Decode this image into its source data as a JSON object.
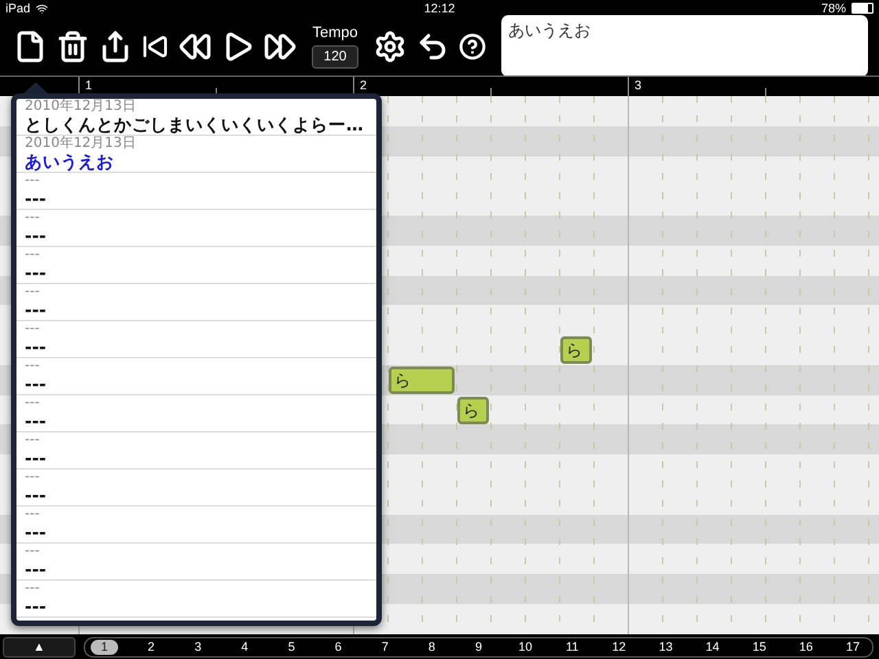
{
  "status_bar": {
    "device": "iPad",
    "time": "12:12",
    "battery": "78%"
  },
  "toolbar": {
    "tempo_label": "Tempo",
    "tempo_value": "120",
    "lyrics": "あいうえお"
  },
  "ruler": [
    "1",
    "2",
    "3"
  ],
  "song_list": [
    {
      "date": "2010年12月13日",
      "title": "としくんとかごしまいくいくいくよらー…",
      "selected": false
    },
    {
      "date": "2010年12月13日",
      "title": "あいうえお",
      "selected": true
    },
    {
      "date": "---",
      "title": "---",
      "selected": false
    },
    {
      "date": "---",
      "title": "---",
      "selected": false
    },
    {
      "date": "---",
      "title": "---",
      "selected": false
    },
    {
      "date": "---",
      "title": "---",
      "selected": false
    },
    {
      "date": "---",
      "title": "---",
      "selected": false
    },
    {
      "date": "---",
      "title": "---",
      "selected": false
    },
    {
      "date": "---",
      "title": "---",
      "selected": false
    },
    {
      "date": "---",
      "title": "---",
      "selected": false
    },
    {
      "date": "---",
      "title": "---",
      "selected": false
    },
    {
      "date": "---",
      "title": "---",
      "selected": false
    },
    {
      "date": "---",
      "title": "---",
      "selected": false
    },
    {
      "date": "---",
      "title": "---",
      "selected": false
    }
  ],
  "notes": [
    {
      "lyric": "ら"
    },
    {
      "lyric": "ら"
    },
    {
      "lyric": "ら"
    }
  ],
  "pager": {
    "toggle": "▲",
    "pages": [
      {
        "label": "1",
        "selected": true
      },
      {
        "label": "2",
        "selected": false
      },
      {
        "label": "3",
        "selected": false
      },
      {
        "label": "4",
        "selected": false
      },
      {
        "label": "5",
        "selected": false
      },
      {
        "label": "6",
        "selected": false
      },
      {
        "label": "7",
        "selected": false
      },
      {
        "label": "8",
        "selected": false
      },
      {
        "label": "9",
        "selected": false
      },
      {
        "label": "10",
        "selected": false
      },
      {
        "label": "11",
        "selected": false
      },
      {
        "label": "12",
        "selected": false
      },
      {
        "label": "13",
        "selected": false
      },
      {
        "label": "14",
        "selected": false
      },
      {
        "label": "15",
        "selected": false
      },
      {
        "label": "16",
        "selected": false
      },
      {
        "label": "17",
        "selected": false
      }
    ]
  }
}
